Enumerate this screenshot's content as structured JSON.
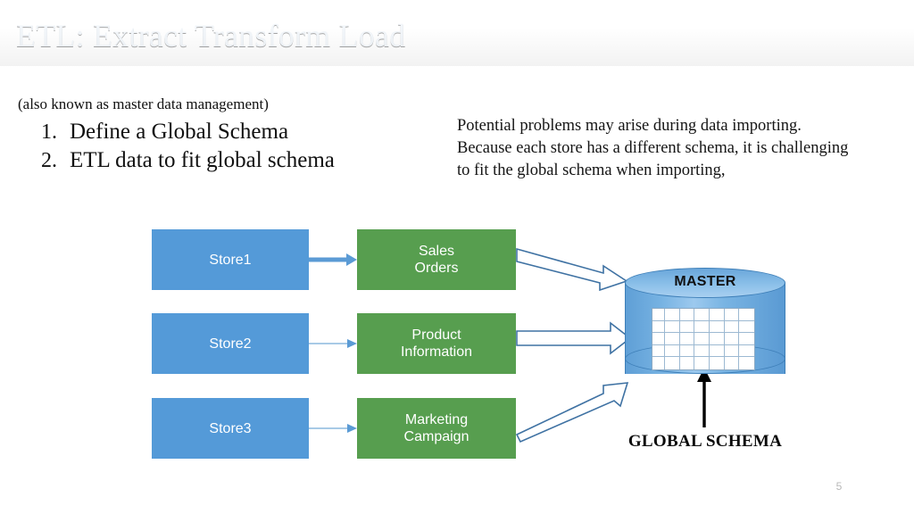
{
  "slide": {
    "title": "ETL: Extract Transform Load",
    "page_number": "5",
    "title_bar_color_left": "#0c2c49",
    "title_bar_color_right": "#1e5280"
  },
  "content": {
    "note": "(also known as master data management)",
    "steps": [
      {
        "num": "1.",
        "label": "Define a Global Schema"
      },
      {
        "num": "2.",
        "label": "ETL data to fit global schema"
      }
    ],
    "paragraph_lines": [
      "Potential problems may arise during data importing.",
      "Because each store has a different schema, it is challenging",
      "to fit the global schema when importing,"
    ]
  },
  "diagram": {
    "store_color": "#549ad8",
    "source_color": "#579e4f",
    "cylinder_color": "#76b2e2",
    "stores": [
      {
        "label": "Store1"
      },
      {
        "label": "Store2"
      },
      {
        "label": "Store3"
      }
    ],
    "sources": [
      {
        "line1": "Sales",
        "line2": "Orders"
      },
      {
        "line1": "Product",
        "line2": "Information"
      },
      {
        "line1": "Marketing",
        "line2": "Campaign"
      }
    ],
    "master": {
      "label": "MASTER",
      "grid_columns": 7,
      "grid_rows": 5
    },
    "global_schema_label": "GLOBAL SCHEMA"
  }
}
